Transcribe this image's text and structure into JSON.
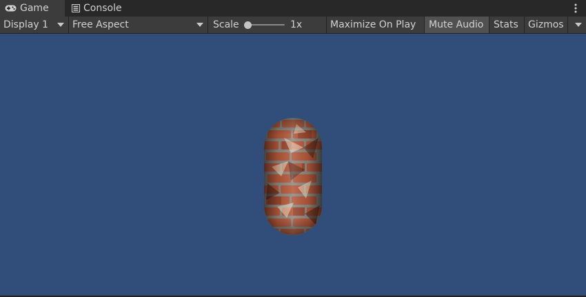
{
  "tabs": {
    "game_label": "Game",
    "console_label": "Console"
  },
  "toolbar": {
    "display_label": "Display 1",
    "aspect_label": "Free Aspect",
    "scale_label": "Scale",
    "scale_value": "1x",
    "maximize_label": "Maximize On Play",
    "mute_label": "Mute Audio",
    "stats_label": "Stats",
    "gizmos_label": "Gizmos"
  },
  "viewport": {
    "background_color": "#314d79",
    "object": "brick-textured-capsule"
  },
  "colors": {
    "panel": "#3c3c3c",
    "tabbar": "#282828",
    "active_toggle": "#515151",
    "text": "#d2d2d2"
  }
}
